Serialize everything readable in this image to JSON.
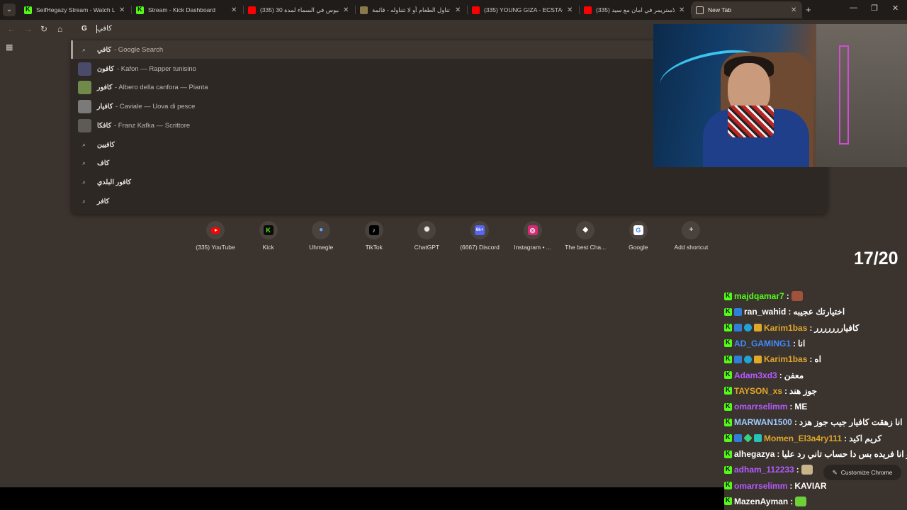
{
  "tabs": [
    {
      "title": "SeifHegazy Stream - Watch Live",
      "icon": "kick-icon",
      "active": false
    },
    {
      "title": "Stream - Kick Dashboard",
      "icon": "kick-icon",
      "active": false
    },
    {
      "title": "(335) محبوس في السماء لمدة 30",
      "icon": "youtube-icon",
      "active": false
    },
    {
      "title": "تناول الطعام أو لا تتناوله - قائمة",
      "icon": "food-icon",
      "active": false
    },
    {
      "title": "(335) YOUNG GIZA - ECSTACY",
      "icon": "youtube-icon",
      "active": false
    },
    {
      "title": "(335) الاستريمر في امان مع سيد",
      "icon": "youtube-icon",
      "active": false
    },
    {
      "title": "New Tab",
      "icon": "globe-icon",
      "active": true
    }
  ],
  "omnibox": {
    "engine": "G",
    "text": "كافي"
  },
  "suggestions": [
    {
      "main": "كافي",
      "desc": "- Google Search",
      "type": "search",
      "selected": true
    },
    {
      "main": "كافون",
      "desc": "- Kafon — Rapper tunisino",
      "type": "entity",
      "thumb_color": "#4a4a6a"
    },
    {
      "main": "كافور",
      "desc": "- Albero della canfora — Pianta",
      "type": "entity",
      "thumb_color": "#6f8a4a"
    },
    {
      "main": "كافيار",
      "desc": "- Caviale — Uova di pesce",
      "type": "entity",
      "thumb_color": "#7a7a7a"
    },
    {
      "main": "كافكا",
      "desc": "- Franz Kafka — Scrittore",
      "type": "entity",
      "thumb_color": "#5e5a55"
    },
    {
      "main": "كافيين",
      "desc": "",
      "type": "search"
    },
    {
      "main": "كاف",
      "desc": "",
      "type": "search"
    },
    {
      "main": "كافور البلدي",
      "desc": "",
      "type": "search"
    },
    {
      "main": "كافر",
      "desc": "",
      "type": "search"
    }
  ],
  "shortcuts": [
    {
      "label": "(335) YouTube",
      "icon": "youtube-icon"
    },
    {
      "label": "Kick",
      "icon": "kick-icon"
    },
    {
      "label": "Uhmegle",
      "icon": "chat-bubble-icon"
    },
    {
      "label": "TikTok",
      "icon": "tiktok-icon"
    },
    {
      "label": "ChatGPT",
      "icon": "chatgpt-icon"
    },
    {
      "label": "(6667) Discord",
      "icon": "discord-icon"
    },
    {
      "label": "Instagram • ...",
      "icon": "instagram-icon"
    },
    {
      "label": "The best Cha...",
      "icon": "dice-icon"
    },
    {
      "label": "Google",
      "icon": "google-icon"
    },
    {
      "label": "Add shortcut",
      "icon": "plus-icon"
    }
  ],
  "counter": "17/20",
  "chat": [
    {
      "user": "majdqamar7",
      "color": "#53fc18",
      "badges": [
        "kick"
      ],
      "message": "",
      "emote": "#a0523a"
    },
    {
      "user": "ran_wahid",
      "color": "#ffffff",
      "badges": [
        "kick",
        "blue"
      ],
      "message": "اختيارتك عجيبه"
    },
    {
      "user": "Karim1bas",
      "color": "#e0a72a",
      "badges": [
        "kick",
        "blue",
        "gem",
        "gold"
      ],
      "message": "كافياررررررر"
    },
    {
      "user": "AD_GAMING1",
      "color": "#3f8cff",
      "badges": [
        "kick"
      ],
      "message": "انا"
    },
    {
      "user": "Karim1bas",
      "color": "#e0a72a",
      "badges": [
        "kick",
        "blue",
        "gem",
        "gold"
      ],
      "message": "اه"
    },
    {
      "user": "Adam3xd3",
      "color": "#b45cff",
      "badges": [
        "kick"
      ],
      "message": "معفن"
    },
    {
      "user": "TAYSON_xs",
      "color": "#e0a72a",
      "badges": [
        "kick"
      ],
      "message": "جوز هند"
    },
    {
      "user": "omarrselimm",
      "color": "#b45cff",
      "badges": [
        "kick"
      ],
      "message": "ME"
    },
    {
      "user": "MARWAN1500",
      "color": "#9ec8ff",
      "badges": [
        "kick"
      ],
      "message": "انا زهقت كافيار جيب جوز هزد"
    },
    {
      "user": "Momen_El3a4ry111",
      "color": "#e0a72a",
      "badges": [
        "kick",
        "blue",
        "green",
        "teal"
      ],
      "message": "كريم اكيد"
    },
    {
      "user": "alhegazya",
      "color": "#ffffff",
      "badges": [
        "kick"
      ],
      "message": "يسيفو انا فريده بس دا حساب تاني رد عليا"
    },
    {
      "user": "adham_112233",
      "color": "#b45cff",
      "badges": [
        "kick"
      ],
      "message": "",
      "emote": "#c9b58a"
    },
    {
      "user": "omarrselimm",
      "color": "#b45cff",
      "badges": [
        "kick"
      ],
      "message": "KAVIAR"
    },
    {
      "user": "MazenAyman",
      "color": "#ffffff",
      "badges": [
        "kick"
      ],
      "message": "",
      "emote": "#6fcf3a"
    }
  ],
  "customize_label": "Customize Chrome"
}
